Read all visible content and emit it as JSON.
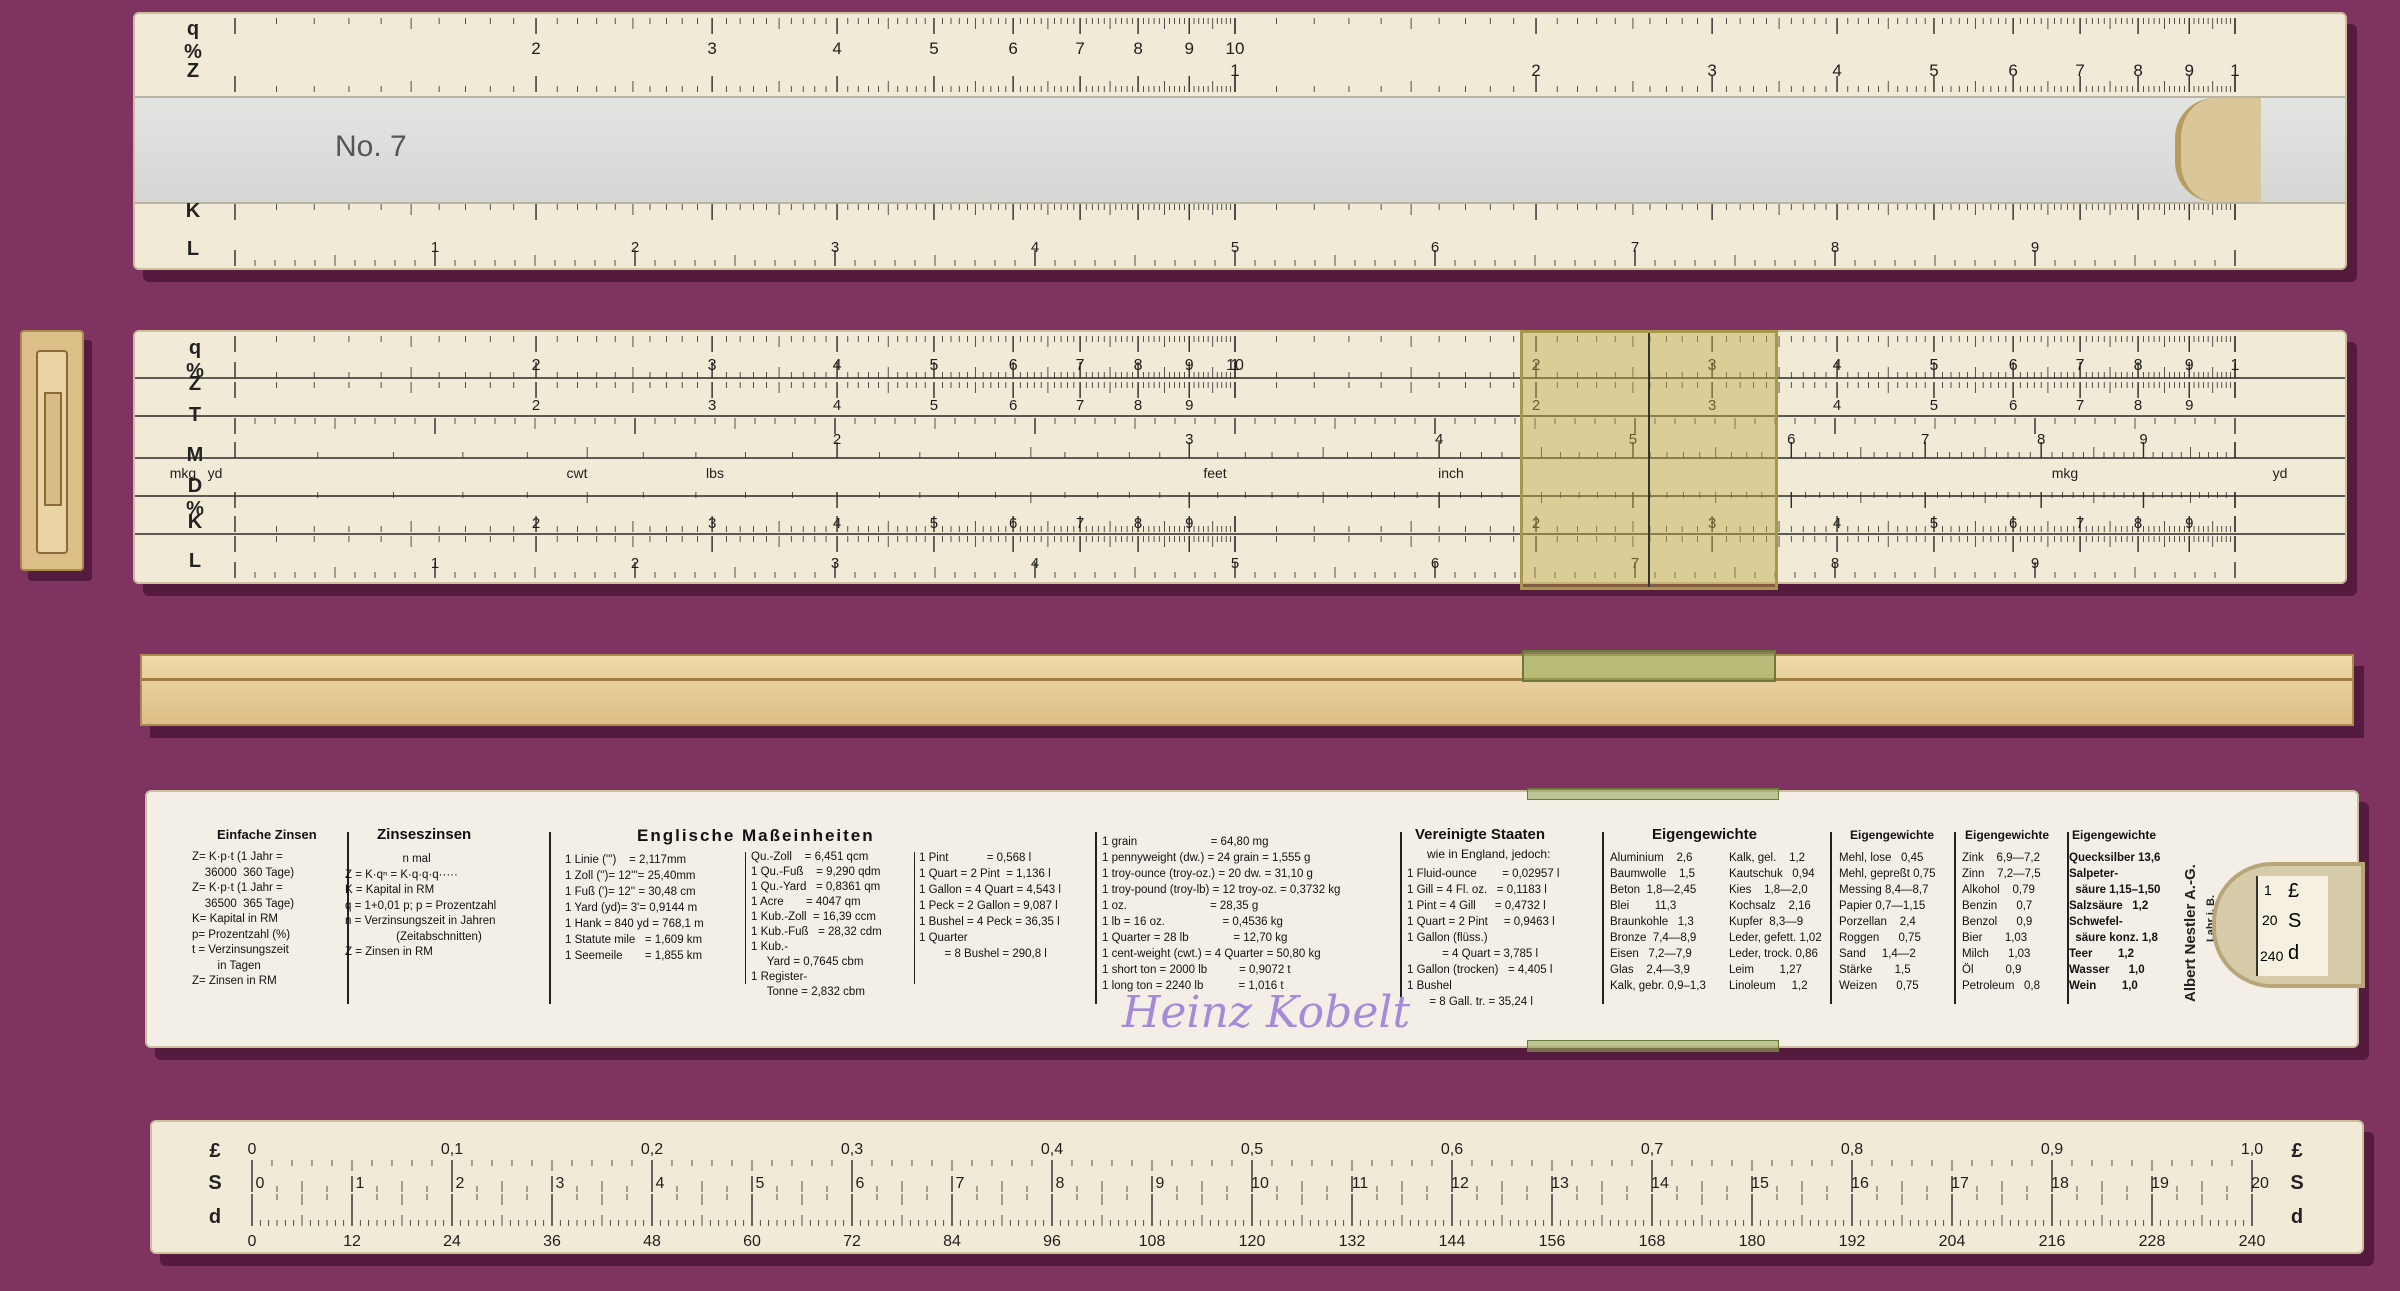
{
  "rule1": {
    "labels": [
      "q %",
      "Z",
      "K",
      "L"
    ],
    "model": "No. 7"
  },
  "rule2": {
    "labels": [
      "q %",
      "Z",
      "T",
      "M",
      "D %",
      "K",
      "L"
    ],
    "units": [
      "mkg",
      "yd",
      "cwt",
      "lbs",
      "feet",
      "inch",
      "mkg",
      "yd"
    ]
  },
  "back": {
    "sections": {
      "einfache": {
        "title": "Einfache Zinsen",
        "body": "Z= K·p·t (1 Jahr =\n    36000  360 Tage)\nZ= K·p·t (1 Jahr =\n    36500  365 Tage)\nK= Kapital in RM\np= Prozentzahl (%)\nt = Verzinsungszeit\n        in Tagen\nZ= Zinsen in RM"
      },
      "zinseszinsen": {
        "title": "Zinseszinsen",
        "body": "                  n mal\nZ = K·qⁿ = K·q·q·q·····\nK = Kapital in RM\nq = 1+0,01 p; p = Prozentzahl\nn = Verzinsungszeit in Jahren\n                (Zeitabschnitten)\nZ = Zinsen in RM"
      },
      "englisch": {
        "title": "Englische Maßeinheiten",
        "col1": "1 Linie (''')    = 2,117mm\n1 Zoll ('')= 12'''= 25,40mm\n1 Fuß (')= 12'' = 30,48 cm\n1 Yard (yd)= 3'= 0,9144 m\n1 Hank = 840 yd = 768,1 m\n1 Statute mile   = 1,609 km\n1 Seemeile       = 1,855 km",
        "col2": "Qu.-Zoll    = 6,451 qcm\n1 Qu.-Fuß    = 9,290 qdm\n1 Qu.-Yard   = 0,8361 qm\n1 Acre       = 4047 qm\n1 Kub.-Zoll  = 16,39 ccm\n1 Kub.-Fuß   = 28,32 cdm\n1 Kub.-\n     Yard = 0,7645 cbm\n1 Register-\n     Tonne = 2,832 cbm",
        "col3": "1 Pint            = 0,568 l\n1 Quart = 2 Pint  = 1,136 l\n1 Gallon = 4 Quart = 4,543 l\n1 Peck = 2 Gallon = 9,087 l\n1 Bushel = 4 Peck = 36,35 l\n1 Quarter\n        = 8 Bushel = 290,8 l",
        "col4": "1 grain                       = 64,80 mg\n1 pennyweight (dw.) = 24 grain = 1,555 g\n1 troy-ounce (troy-oz.) = 20 dw. = 31,10 g\n1 troy-pound (troy-lb) = 12 troy-oz. = 0,3732 kg\n1 oz.                          = 28,35 g\n1 lb = 16 oz.                  = 0,4536 kg\n1 Quarter = 28 lb              = 12,70 kg\n1 cent-weight (cwt.) = 4 Quarter = 50,80 kg\n1 short ton = 2000 lb          = 0,9072 t\n1 long ton = 2240 lb           = 1,016 t"
      },
      "vereinigte": {
        "title": "Vereinigte Staaten",
        "subtitle": "wie in England, jedoch:",
        "body": "1 Fluid-ounce        = 0,02957 l\n1 Gill = 4 Fl. oz.   = 0,1183 l\n1 Pint = 4 Gill      = 0,4732 l\n1 Quart = 2 Pint     = 0,9463 l\n1 Gallon (flüss.)\n           = 4 Quart = 3,785 l\n1 Gallon (trocken)   = 4,405 l\n1 Bushel\n       = 8 Gall. tr. = 35,24 l"
      },
      "eigengewichte1": {
        "title": "Eigengewichte",
        "col1": "Aluminium    2,6\nBaumwolle    1,5\nBeton  1,8—2,45\nBlei        11,3\nBraunkohle   1,3\nBronze  7,4—8,9\nEisen   7,2—7,9\nGlas    2,4—3,9\nKalk, gebr. 0,9–1,3",
        "col2": "Kalk, gel.    1,2\nKautschuk   0,94\nKies    1,8—2,0\nKochsalz    2,16\nKupfer  8,3—9\nLeder, gefett. 1,02\nLeder, trock. 0,86\nLeim        1,27\nLinoleum     1,2"
      },
      "eigengewichte2": {
        "title": "Eigengewichte",
        "body": "Mehl, lose   0,45\nMehl, gepreßt 0,75\nMessing 8,4—8,7\nPapier 0,7—1,15\nPorzellan    2,4\nRoggen      0,75\nSand     1,4—2\nStärke       1,5\nWeizen      0,75"
      },
      "eigengewichte3": {
        "title": "Eigengewichte",
        "body": "Zink    6,9—7,2\nZinn    7,2—7,5\nAlkohol    0,79\nBenzin      0,7\nBenzol      0,9\nBier       1,03\nMilch      1,03\nÖl          0,9\nPetroleum   0,8"
      },
      "eigengewichte4": {
        "title": "Eigengewichte",
        "body": "Quecksilber 13,6\nSalpeter-\n  säure 1,15–1,50\nSalzsäure   1,2\nSchwefel-\n  säure konz. 1,8\nTeer        1,2\nWasser      1,0\nWein        1,0"
      }
    },
    "maker": "Albert Nestler A.-G.",
    "maker_place": "Lahr i. B.",
    "owner_signature": "Heinz Kobelt",
    "slide_labels": [
      "£",
      "S",
      "d"
    ],
    "slide_numbers": [
      "1",
      "0",
      "10",
      "20",
      "240"
    ]
  },
  "slide": {
    "labels_left": [
      "£",
      "S",
      "d"
    ],
    "labels_right": [
      "£",
      "S",
      "d"
    ],
    "pound_ticks": [
      "0",
      "0,1",
      "0,2",
      "0,3",
      "0,4",
      "0,5",
      "0,6",
      "0,7",
      "0,8",
      "0,9",
      "1,0"
    ],
    "shilling_ticks": [
      "0",
      "1",
      "2",
      "3",
      "4",
      "5",
      "6",
      "7",
      "8",
      "9",
      "10",
      "11",
      "12",
      "13",
      "14",
      "15",
      "16",
      "17",
      "18",
      "19",
      "20"
    ],
    "pence_ticks": [
      "0",
      "12",
      "24",
      "36",
      "48",
      "60",
      "72",
      "84",
      "96",
      "108",
      "120",
      "132",
      "144",
      "156",
      "168",
      "180",
      "192",
      "204",
      "216",
      "228",
      "240"
    ]
  },
  "colors": {
    "background": "#7e3360",
    "ivory": "#f1ead6",
    "wood": "#e4c997",
    "cursor": "#c8b45a",
    "signature": "#a48ad8"
  }
}
